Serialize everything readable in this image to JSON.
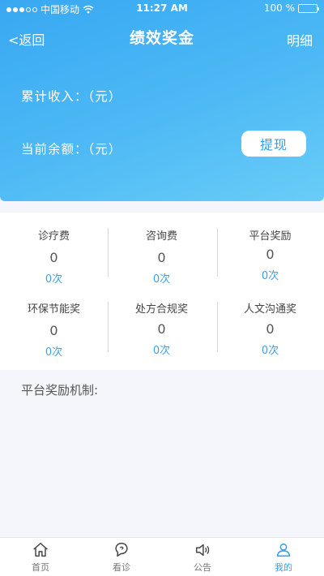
{
  "status": {
    "carrier": "中国移动",
    "time": "11:27 AM",
    "battery": "100 %"
  },
  "nav": {
    "back_label": "<返回",
    "title": "绩效奖金",
    "detail_label": "明细"
  },
  "summary": {
    "total_income_label": "累计收入：（元）",
    "balance_label": "当前余额：（元）",
    "withdraw_label": "提现"
  },
  "stats": [
    {
      "label": "诊疗费",
      "value": "0",
      "count": "0次"
    },
    {
      "label": "咨询费",
      "value": "0",
      "count": "0次"
    },
    {
      "label": "平台奖励",
      "value": "0",
      "count": "0次"
    },
    {
      "label": "环保节能奖",
      "value": "0",
      "count": "0次"
    },
    {
      "label": "处方合规奖",
      "value": "0",
      "count": "0次"
    },
    {
      "label": "人文沟通奖",
      "value": "0",
      "count": "0次"
    }
  ],
  "mechanism": {
    "title": "平台奖励机制:"
  },
  "tabbar": {
    "items": [
      {
        "label": "首页",
        "icon": "home-icon"
      },
      {
        "label": "看诊",
        "icon": "consult-icon"
      },
      {
        "label": "公告",
        "icon": "announcement-icon"
      },
      {
        "label": "我的",
        "icon": "profile-icon"
      }
    ],
    "active_index": 3
  },
  "colors": {
    "accent": "#3aa0e8",
    "header_start": "#38a8f2",
    "header_end": "#69cdf6",
    "page_bg": "#f4f6fb"
  }
}
